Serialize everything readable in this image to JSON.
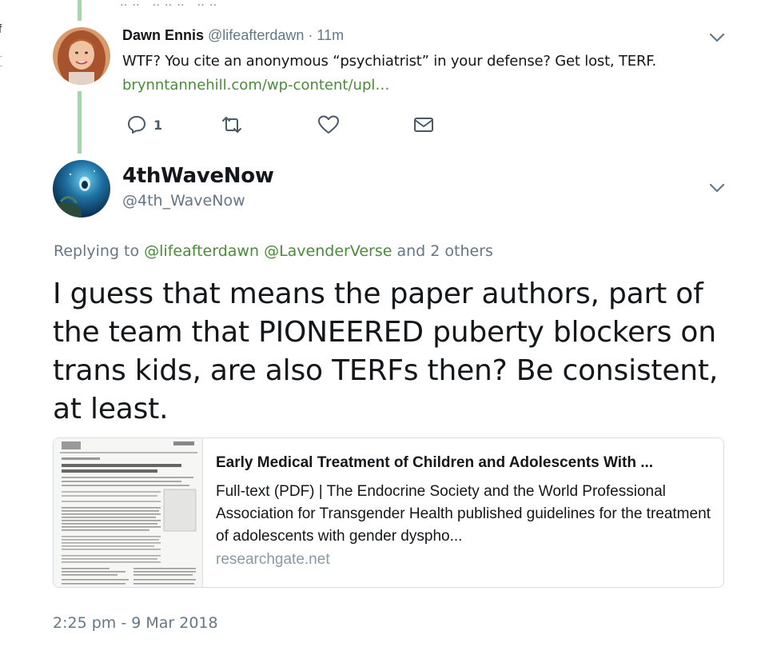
{
  "reply_tweet": {
    "display_name": "Dawn Ennis",
    "handle": "@lifeafterdawn",
    "separator": "·",
    "time_ago": "11m",
    "text": "WTF? You cite an anonymous “psychiatrist” in your defense? Get lost, TERF.",
    "link_text": "brynntannehill.com/wp-content/upl…",
    "reply_count": "1",
    "icons": [
      "reply-icon",
      "retweet-icon",
      "like-icon",
      "direct-message-icon",
      "chevron-down-icon"
    ]
  },
  "main_tweet": {
    "display_name": "4thWaveNow",
    "handle": "@4th_WaveNow",
    "replying_prefix": "Replying to",
    "replying_mentions": [
      "@lifeafterdawn",
      "@LavenderVerse"
    ],
    "replying_suffix": "and 2 others",
    "text": "I guess that means the paper authors, part of the team that PIONEERED puberty blockers on trans kids, are also TERFs then? Be consistent, at least.",
    "timestamp": "2:25 pm - 9 Mar 2018"
  },
  "link_card": {
    "title": "Early Medical Treatment of Children and Adolescents With ...",
    "description": "Full-text (PDF) | The Endocrine Society and the World Professional Association for Transgender Health published guidelines for the treatment of adolescents with gender dyspho...",
    "domain": "researchgate.net"
  },
  "colors": {
    "link_green": "#4b8b3b",
    "thread_line": "#9fd9a8",
    "muted_text": "#657786",
    "card_border": "#d8dee2"
  }
}
